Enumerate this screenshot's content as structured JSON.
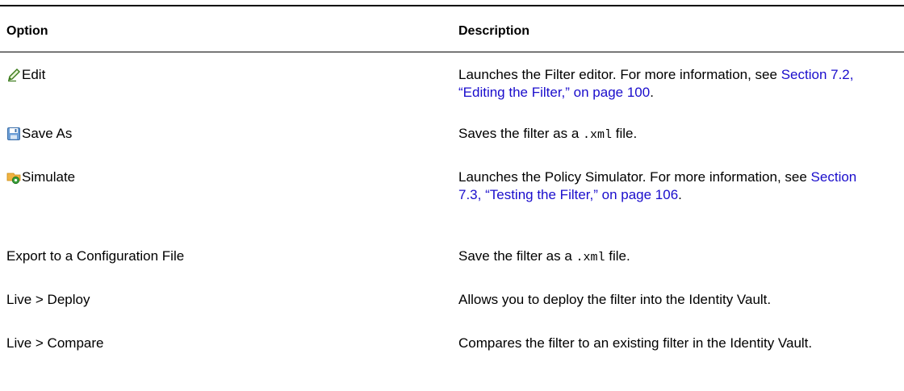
{
  "table": {
    "headers": {
      "option": "Option",
      "description": "Description"
    },
    "rows": [
      {
        "option": "Edit",
        "icon": "edit-pencil-icon",
        "desc_text": "Launches the Filter editor. For more information, see ",
        "desc_link": "Section 7.2, “Editing the Filter,” on page 100",
        "desc_after": "."
      },
      {
        "option": "Save As",
        "icon": "save-disk-icon",
        "desc_text": "Saves the filter as a ",
        "desc_code": ".xml",
        "desc_after": " file."
      },
      {
        "option": "Simulate",
        "icon": "simulate-icon",
        "desc_text": "Launches the Policy Simulator. For more information, see ",
        "desc_link": "Section 7.3, “Testing the Filter,” on page 106",
        "desc_after": "."
      },
      {
        "option": "Export to a Configuration File",
        "desc_text": "Save the filter as a ",
        "desc_code": ".xml",
        "desc_after": " file."
      },
      {
        "option": "Live > Deploy",
        "desc_text": "Allows you to deploy the filter into the Identity Vault."
      },
      {
        "option": "Live > Compare",
        "desc_text": "Compares the filter to an existing filter in the Identity Vault."
      }
    ]
  },
  "colors": {
    "link": "#1a0dcc",
    "rule": "#000000"
  }
}
